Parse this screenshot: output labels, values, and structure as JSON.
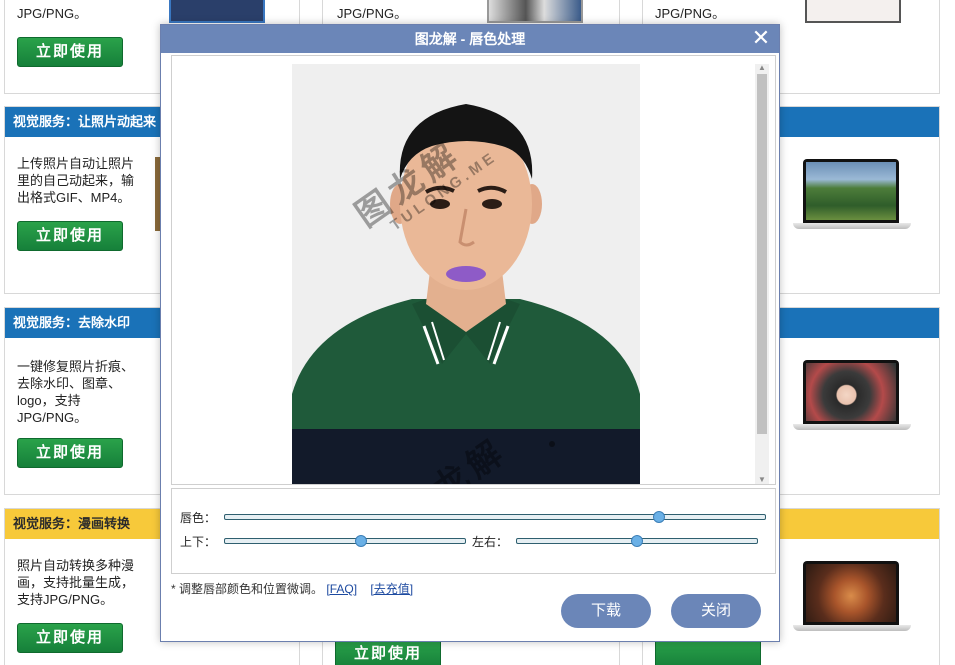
{
  "cards_top": {
    "left_desc": "JPG/PNG。",
    "mid_desc": "JPG/PNG。",
    "right_desc": "JPG/PNG。",
    "button": "立即使用"
  },
  "card_animate": {
    "title": "视觉服务：让照片动起来",
    "desc": "上传照片自动让照片里的自己动起来，输出格式GIF、MP4。",
    "button": "立即使用"
  },
  "card_watermark": {
    "title": "视觉服务：去除水印",
    "desc": "一键修复照片折痕、去除水印、图章、logo，支持JPG/PNG。",
    "button": "立即使用"
  },
  "card_comic": {
    "title": "视觉服务：漫画转换",
    "desc": "照片自动转换多种漫画，支持批量生成，支持JPG/PNG。",
    "button": "立即使用"
  },
  "bottom_buttons": {
    "mid": "立即使用"
  },
  "dialog": {
    "title": "图龙解 - 唇色处理",
    "close_icon": "close-icon",
    "watermark_cn": "图龙解",
    "watermark_en": "TULONG.ME",
    "lip_color_label": "唇色：",
    "vertical_label": "上下：",
    "horizontal_label": "左右：",
    "lip_color_level": 0.8,
    "vertical_level": 0.57,
    "horizontal_level": 0.5,
    "note_text": "* 调整唇部颜色和位置微调。",
    "faq_link": "[FAQ]",
    "recharge_link": "[去充值]",
    "download_button": "下载",
    "close_button": "关闭"
  },
  "colors": {
    "header_blue": "#1a72b8",
    "header_yellow": "#f7c93a",
    "button_green": "#16803a",
    "dialog_accent": "#6b86b8",
    "lip_purple": "#8e5bc7"
  }
}
